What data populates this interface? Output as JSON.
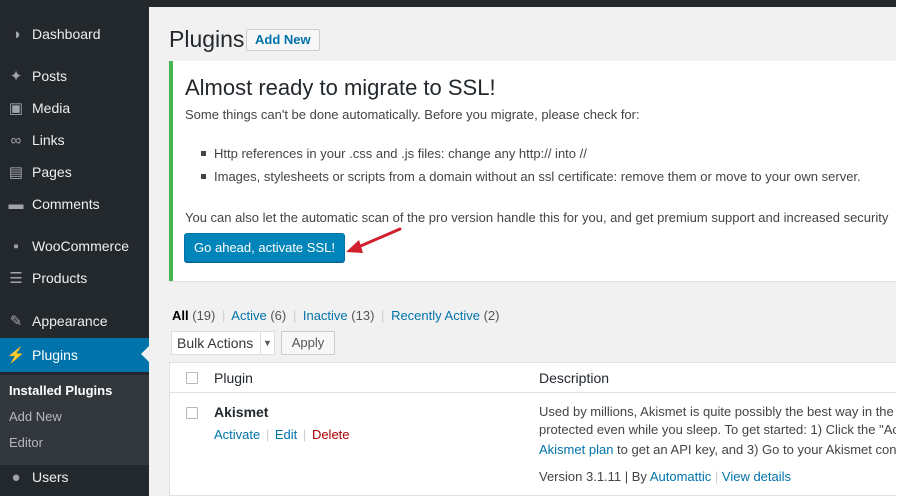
{
  "sidebar": {
    "items": [
      {
        "label": "Dashboard",
        "icon": "dashboard-icon",
        "glyph": "◑"
      },
      {
        "label": "Posts",
        "icon": "pin-icon",
        "glyph": "✦"
      },
      {
        "label": "Media",
        "icon": "media-icon",
        "glyph": "▣"
      },
      {
        "label": "Links",
        "icon": "link-icon",
        "glyph": "∞"
      },
      {
        "label": "Pages",
        "icon": "pages-icon",
        "glyph": "▤"
      },
      {
        "label": "Comments",
        "icon": "comment-icon",
        "glyph": "▬"
      },
      {
        "label": "WooCommerce",
        "icon": "woo-icon",
        "glyph": "▪"
      },
      {
        "label": "Products",
        "icon": "cart-icon",
        "glyph": "☰"
      },
      {
        "label": "Appearance",
        "icon": "brush-icon",
        "glyph": "✎"
      },
      {
        "label": "Plugins",
        "icon": "plugin-icon",
        "glyph": "⚡"
      },
      {
        "label": "Users",
        "icon": "user-icon",
        "glyph": "●"
      }
    ],
    "submenu": [
      "Installed Plugins",
      "Add New",
      "Editor"
    ]
  },
  "header": {
    "title": "Plugins",
    "add_new": "Add New"
  },
  "notice": {
    "title": "Almost ready to migrate to SSL!",
    "subtitle": "Some things can't be done automatically. Before you migrate, please check for:",
    "items": [
      "Http references in your .css and .js files: change any http:// into //",
      "Images, stylesheets or scripts from a domain without an ssl certificate: remove them or move to your own server."
    ],
    "extra": "You can also let the automatic scan of the pro version handle this for you, and get premium support and increased security",
    "button": "Go ahead, activate SSL!"
  },
  "filters": {
    "all": "All",
    "all_count": "(19)",
    "active": "Active",
    "active_count": "(6)",
    "inactive": "Inactive",
    "inactive_count": "(13)",
    "recent": "Recently Active",
    "recent_count": "(2)",
    "sep": "|"
  },
  "bulk": {
    "selected": "Bulk Actions",
    "apply": "Apply"
  },
  "table": {
    "headers": {
      "plugin": "Plugin",
      "description": "Description"
    },
    "rows": [
      {
        "name": "Akismet",
        "actions": {
          "activate": "Activate",
          "edit": "Edit",
          "delete": "Delete",
          "sep": "|"
        },
        "description": [
          "Used by millions, Akismet is quite possibly the best way in the",
          "protected even while you sleep. To get started: 1) Click the \"Ac"
        ],
        "desc_link": "Akismet plan",
        "desc_after_link": " to get an API key, and 3) Go to your Akismet conf",
        "version": "Version 3.1.11",
        "by": " | By ",
        "author": "Automattic",
        "details": "View details",
        "meta_sep": "|"
      }
    ]
  },
  "colors": {
    "accent": "#0073aa",
    "sidebar": "#23282d",
    "notice_border": "#46b450",
    "arrow": "#d0202e"
  }
}
